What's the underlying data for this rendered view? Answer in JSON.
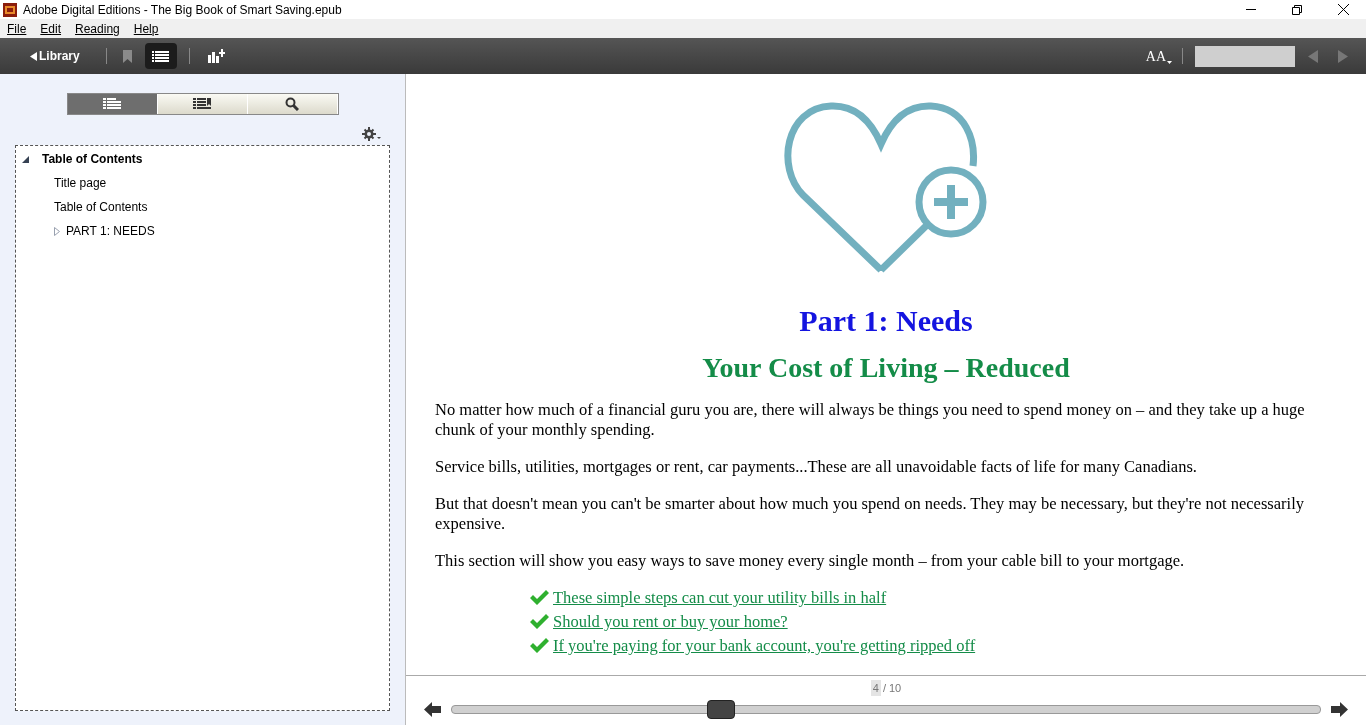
{
  "window": {
    "title": "Adobe Digital Editions - The Big Book of Smart Saving.epub"
  },
  "menu": [
    "File",
    "Edit",
    "Reading",
    "Help"
  ],
  "toolbar": {
    "library": "Library",
    "bookmark_on": false,
    "toc_selected": true,
    "font_size": "AA"
  },
  "sidebar": {
    "tabs": [
      {
        "kind": "contents",
        "selected": true
      },
      {
        "kind": "bookmarks",
        "selected": false
      },
      {
        "kind": "search",
        "selected": false
      }
    ],
    "toc": [
      {
        "label": "Table of Contents",
        "expanded": true,
        "children": [
          {
            "label": "Title page"
          },
          {
            "label": "Table of Contents"
          },
          {
            "label": "PART 1: NEEDS",
            "expanded": false
          }
        ]
      }
    ]
  },
  "page": {
    "heading": "Part 1: Needs",
    "subheading": "Your Cost of Living – Reduced",
    "paragraphs": [
      "No matter how much of a financial guru you are, there will always be things you need to spend money on – and they take up a huge chunk of your monthly spending.",
      "Service bills, utilities, mortgages or rent, car payments...These are all unavoidable facts of life for many Canadians.",
      "But that doesn't mean you can't be smarter about how much you spend on needs. They may be necessary, but they're not necessarily expensive.",
      "This section will show you easy ways to save money every single month – from your cable bill to your mortgage."
    ],
    "links": [
      "These simple steps can cut your utility bills in half",
      "Should you rent or buy your home?",
      "If you're paying for your bank account, you're getting ripped off"
    ]
  },
  "footer": {
    "page": "4",
    "total": "/ 10",
    "level": 0.31
  }
}
